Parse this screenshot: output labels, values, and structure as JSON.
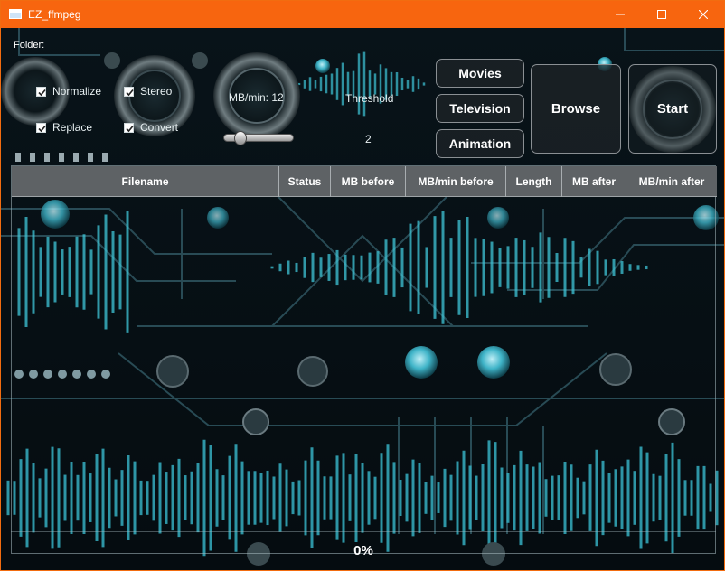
{
  "window": {
    "title": "EZ_ffmpeg",
    "icons": {
      "app": "app-window-icon",
      "minimize": "minimize-icon",
      "maximize": "maximize-icon",
      "close": "close-icon"
    }
  },
  "folder": {
    "label": "Folder:"
  },
  "options": {
    "normalize": {
      "label": "Normalize",
      "checked": true
    },
    "stereo": {
      "label": "Stereo",
      "checked": true
    },
    "replace": {
      "label": "Replace",
      "checked": true
    },
    "convert": {
      "label": "Convert",
      "checked": true
    }
  },
  "mb_per_min": {
    "label": "MB/min: 12",
    "slider_value": 12
  },
  "threshold": {
    "label": "Threshold",
    "value": "2"
  },
  "presets": {
    "movies": "Movies",
    "television": "Television",
    "animation": "Animation"
  },
  "actions": {
    "browse": "Browse",
    "start": "Start"
  },
  "table": {
    "columns": [
      "Filename",
      "Status",
      "MB before",
      "MB/min before",
      "Length",
      "MB after",
      "MB/min after"
    ],
    "rows": []
  },
  "progress": {
    "text": "0%",
    "fraction": 0
  },
  "colors": {
    "titlebar": "#f7650f",
    "accent_cyan": "#3fc6d8",
    "button_border": "#8a8f93"
  }
}
